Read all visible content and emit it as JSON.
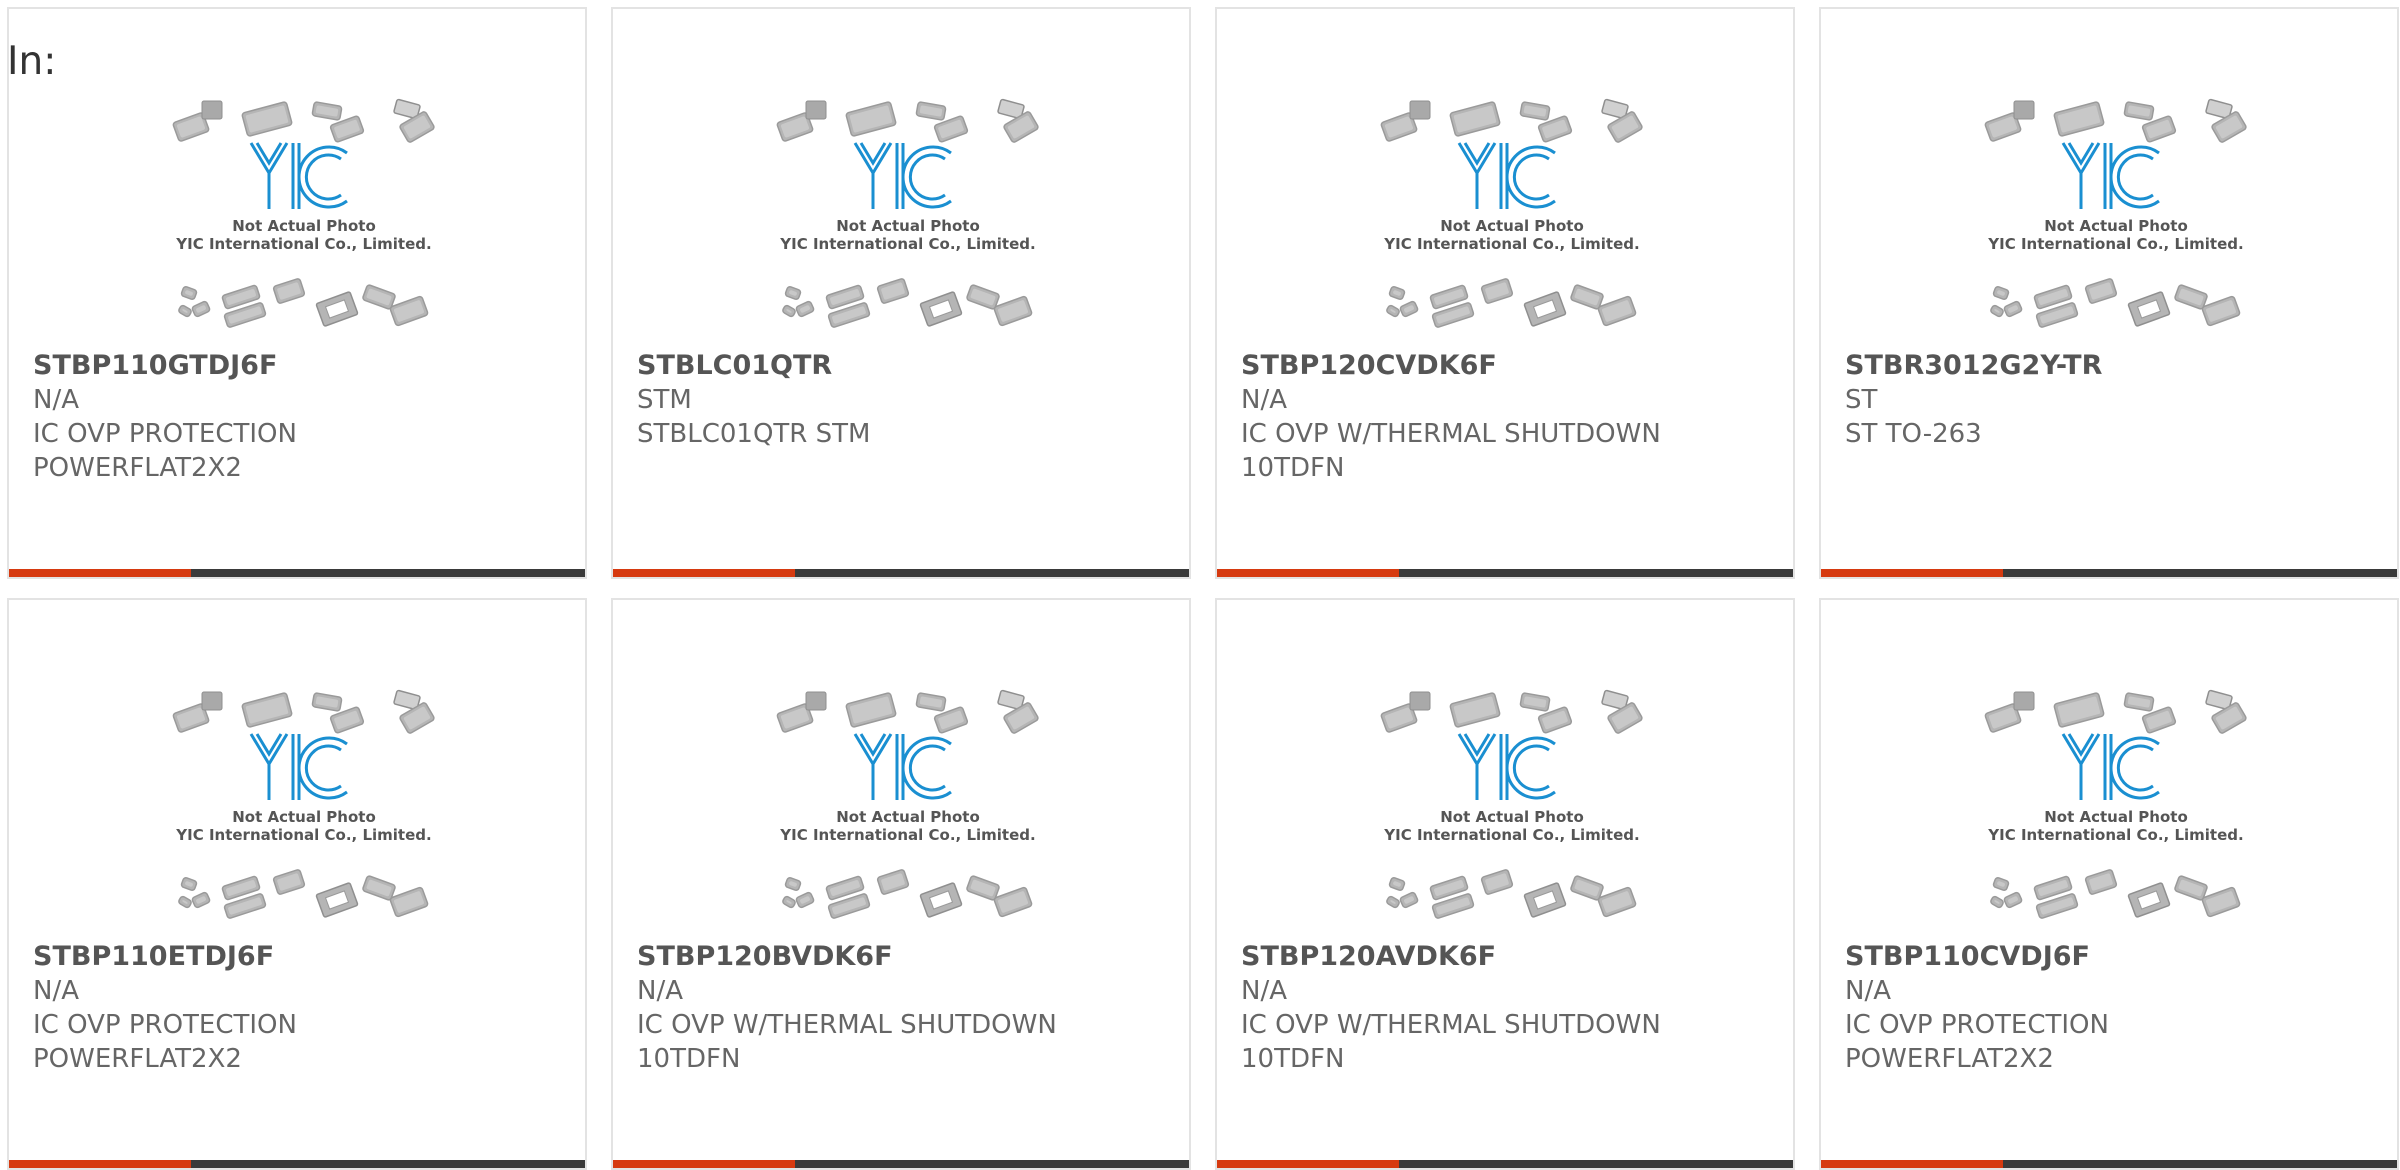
{
  "header": {
    "label": "In:"
  },
  "thumbnail": {
    "caption_line1": "Not Actual Photo",
    "caption_line2": "YIC International Co., Limited.",
    "logo_text": "YIC"
  },
  "colors": {
    "accent_bar": "#d63a10",
    "bar_base": "#3a3a3a",
    "logo_blue": "#1a8fd1",
    "text_gray": "#666666"
  },
  "products": [
    {
      "part": "STBP110GTDJ6F",
      "line1": "N/A",
      "line2": "IC OVP PROTECTION",
      "line3": "POWERFLAT2X2"
    },
    {
      "part": "STBLC01QTR",
      "line1": "STM",
      "line2": "STBLC01QTR STM",
      "line3": ""
    },
    {
      "part": "STBP120CVDK6F",
      "line1": "N/A",
      "line2": "IC OVP W/THERMAL SHUTDOWN",
      "line3": "10TDFN"
    },
    {
      "part": "STBR3012G2Y-TR",
      "line1": "ST",
      "line2": "ST TO-263",
      "line3": ""
    },
    {
      "part": "STBP110ETDJ6F",
      "line1": "N/A",
      "line2": "IC OVP PROTECTION",
      "line3": "POWERFLAT2X2"
    },
    {
      "part": "STBP120BVDK6F",
      "line1": "N/A",
      "line2": "IC OVP W/THERMAL SHUTDOWN",
      "line3": "10TDFN"
    },
    {
      "part": "STBP120AVDK6F",
      "line1": "N/A",
      "line2": "IC OVP W/THERMAL SHUTDOWN",
      "line3": "10TDFN"
    },
    {
      "part": "STBP110CVDJ6F",
      "line1": "N/A",
      "line2": "IC OVP PROTECTION",
      "line3": "POWERFLAT2X2"
    }
  ]
}
